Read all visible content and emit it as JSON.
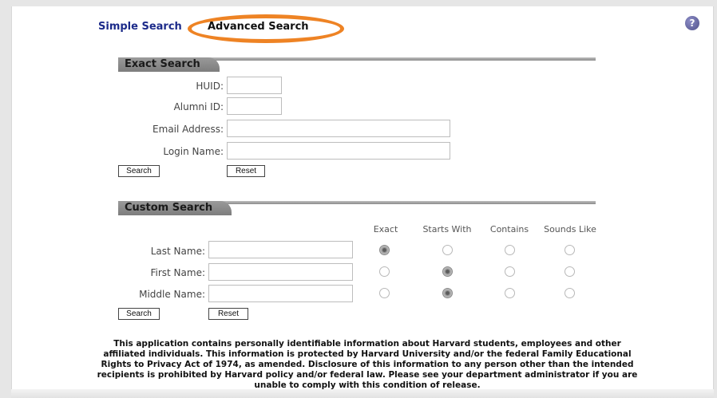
{
  "tabs": {
    "simple_label": "Simple Search",
    "advanced_label": "Advanced Search"
  },
  "help": {
    "icon_text": "?"
  },
  "exact_search": {
    "title": "Exact Search",
    "fields": [
      {
        "label": "HUID:",
        "value": "",
        "placeholder": ""
      },
      {
        "label": "Alumni ID:",
        "value": "",
        "placeholder": ""
      },
      {
        "label": "Email Address:",
        "value": "",
        "placeholder": ""
      },
      {
        "label": "Login Name:",
        "value": "",
        "placeholder": ""
      }
    ],
    "search_label": "Search",
    "reset_label": "Reset"
  },
  "custom_search": {
    "title": "Custom Search",
    "columns": [
      "Exact",
      "Starts With",
      "Contains",
      "Sounds Like"
    ],
    "rows": [
      {
        "label": "Last Name:",
        "value": "",
        "selected": "Exact"
      },
      {
        "label": "First Name:",
        "value": "",
        "selected": "Starts With"
      },
      {
        "label": "Middle Name:",
        "value": "",
        "selected": "Starts With"
      }
    ],
    "search_label": "Search",
    "reset_label": "Reset"
  },
  "disclaimer": "This application contains personally identifiable information about Harvard students, employees and other affiliated individuals. This information is protected by Harvard University and/or the federal Family Educational Rights to Privacy Act of 1974, as amended. Disclosure of this information to any person other than the intended recipients is prohibited by Harvard policy and/or federal law. Please see your department administrator if you are unable to comply with this condition of release.",
  "colors": {
    "highlight_ring": "#ee8324",
    "link_blue": "#1c2b8a",
    "section_header": "#8c8c8c",
    "help_icon": "#6a6ba6"
  }
}
